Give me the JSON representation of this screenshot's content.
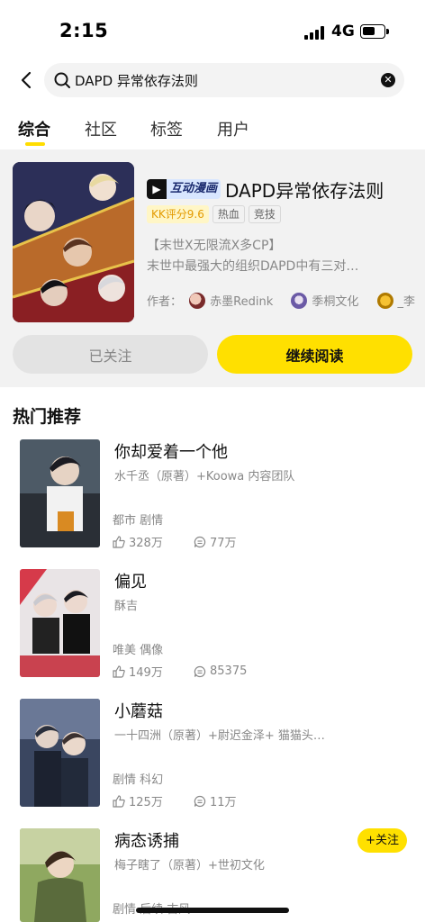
{
  "status_bar": {
    "time": "2:15",
    "network": "4G"
  },
  "search": {
    "query": "DAPD 异常依存法则"
  },
  "tabs": [
    {
      "label": "综合"
    },
    {
      "label": "社区"
    },
    {
      "label": "标签"
    },
    {
      "label": "用户"
    }
  ],
  "result": {
    "badge": "互动漫画",
    "title": "DAPD异常依存法则",
    "score": "KK评分9.6",
    "tags": [
      "热血",
      "竞技"
    ],
    "desc_line1": "【末世X无限流X多CP】",
    "desc_line2": "末世中最强大的组织DAPD中有三对…",
    "author_label": "作者：",
    "authors": [
      "赤墨Redink",
      "季桐文化",
      "_李"
    ],
    "followed_label": "已关注",
    "read_label": "继续阅读"
  },
  "recommend": {
    "title": "热门推荐",
    "follow_label": "+关注",
    "items": [
      {
        "title": "你却爱着一个他",
        "author": "水千丞（原著）+Koowa 内容团队",
        "genres": "都市 剧情",
        "likes": "328万",
        "comments": "77万"
      },
      {
        "title": "偏见",
        "author": "酥吉",
        "genres": "唯美 偶像",
        "likes": "149万",
        "comments": "85375"
      },
      {
        "title": "小蘑菇",
        "author": "一十四洲（原著）+尉迟金泽+ 猫猫头…",
        "genres": "剧情 科幻",
        "likes": "125万",
        "comments": "11万"
      },
      {
        "title": "病态诱捕",
        "author": "梅子瞎了（原著）+世初文化",
        "genres": "剧情 后续 古风",
        "likes": "",
        "comments": ""
      }
    ]
  },
  "colors": {
    "accent": "#ffe000",
    "card_bg": "#f2f2f2",
    "text_muted": "#888888"
  }
}
